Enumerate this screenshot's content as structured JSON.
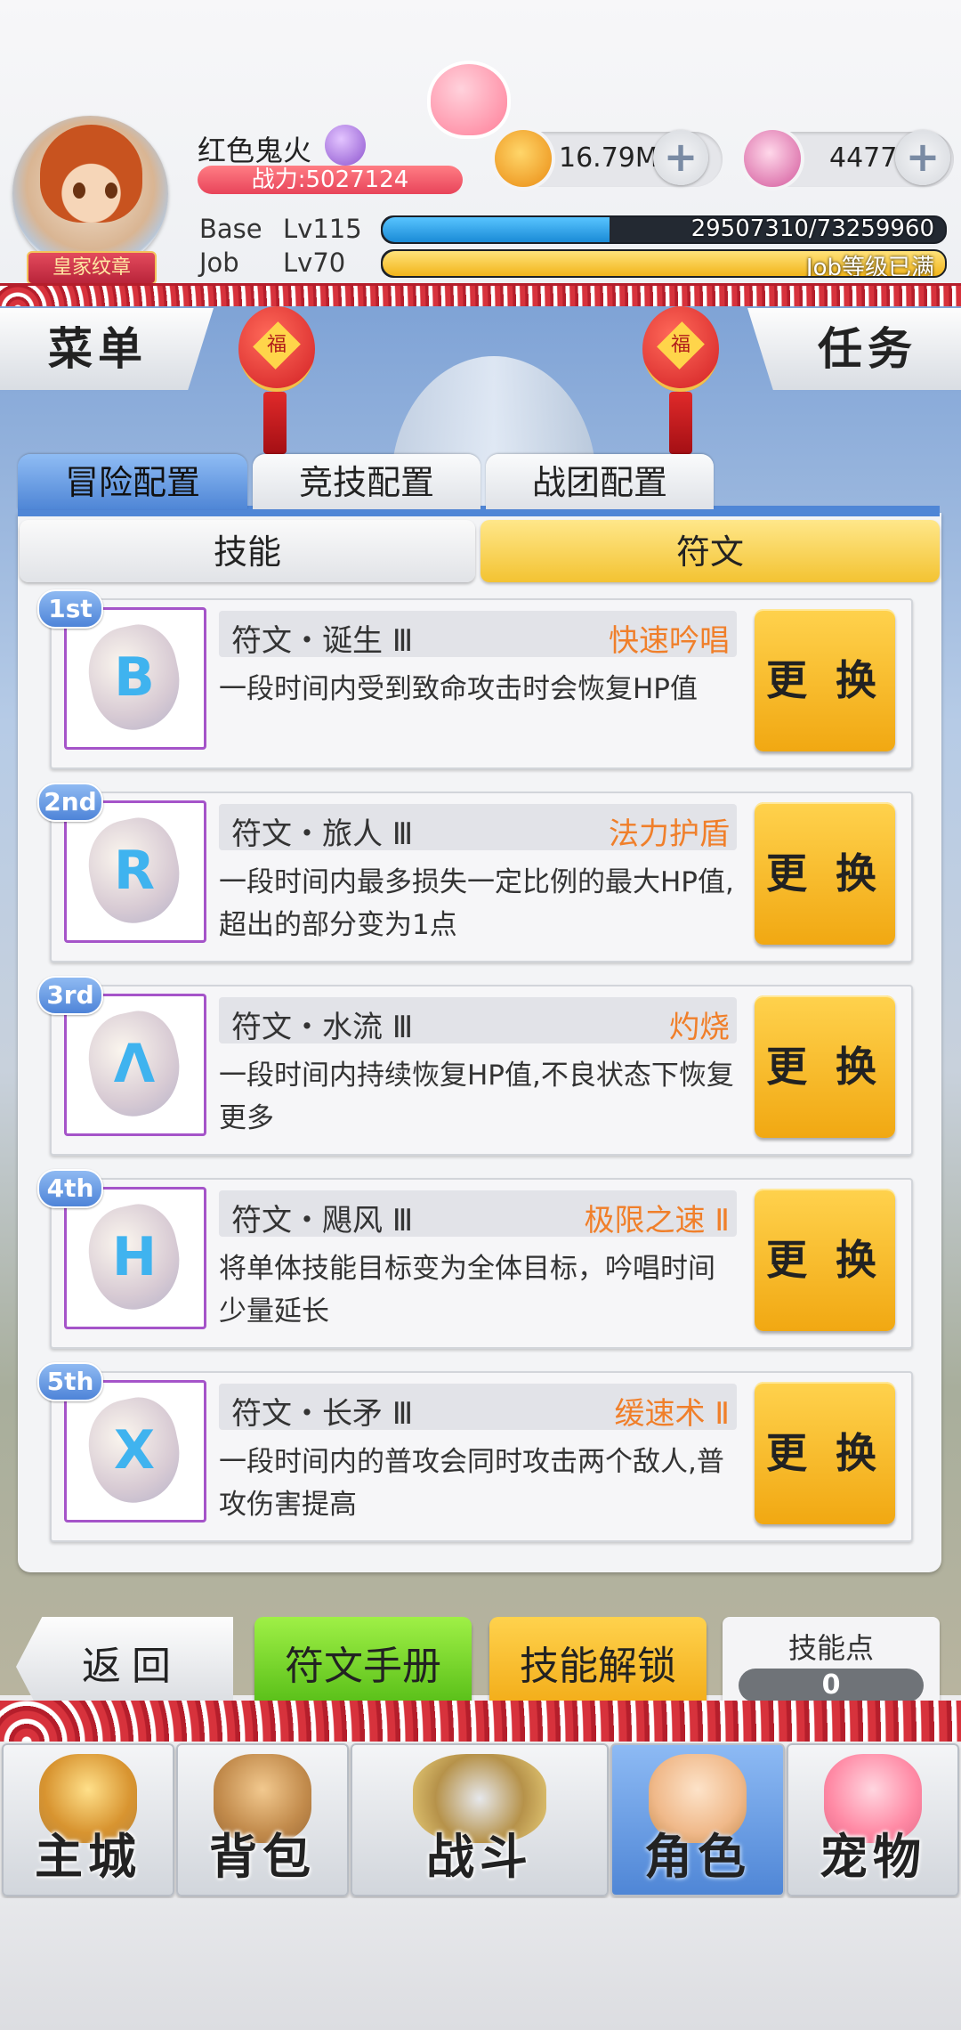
{
  "player": {
    "name": "红色鬼火",
    "badge": "皇家纹章",
    "power": "战力:5027124"
  },
  "currency": {
    "zeny": "16.79M",
    "gems": "4477",
    "plus_symbol": "+"
  },
  "levels": {
    "base_label": "Base",
    "base_level": "Lv115",
    "base_exp": "29507310/73259960",
    "base_progress": 0.403,
    "job_label": "Job",
    "job_level": "Lv70",
    "job_exp": "Job等级已满",
    "job_progress": 1.0
  },
  "side_buttons": {
    "menu": "菜单",
    "task": "任务"
  },
  "lanterns": {
    "char": "福"
  },
  "config_tabs": [
    "冒险配置",
    "竞技配置",
    "战团配置"
  ],
  "sub_tabs": [
    "技能",
    "符文"
  ],
  "runes": [
    {
      "rank": "1st",
      "glyph": "B",
      "name": "符文・诞生 Ⅲ",
      "skill": "快速吟唱",
      "desc": "一段时间内受到致命攻击时会恢复HP值",
      "button": "更 换"
    },
    {
      "rank": "2nd",
      "glyph": "R",
      "name": "符文・旅人 Ⅲ",
      "skill": "法力护盾",
      "desc": "一段时间内最多损失一定比例的最大HP值,超出的部分变为1点",
      "button": "更 换"
    },
    {
      "rank": "3rd",
      "glyph": "Λ",
      "name": "符文・水流 Ⅲ",
      "skill": "灼烧",
      "desc": "一段时间内持续恢复HP值,不良状态下恢复更多",
      "button": "更 换"
    },
    {
      "rank": "4th",
      "glyph": "H",
      "name": "符文・飓风 Ⅲ",
      "skill": "极限之速 Ⅱ",
      "desc": "将单体技能目标变为全体目标，吟唱时间少量延长",
      "button": "更 换"
    },
    {
      "rank": "5th",
      "glyph": "X",
      "name": "符文・长矛 Ⅲ",
      "skill": "缓速术 Ⅱ",
      "desc": "一段时间内的普攻会同时攻击两个敌人,普攻伤害提高",
      "button": "更 换"
    }
  ],
  "actions": {
    "back": "返回",
    "rune_manual": "符文手册",
    "skill_unlock": "技能解锁",
    "skill_points_label": "技能点",
    "skill_points": "0"
  },
  "nav": [
    "主城",
    "背包",
    "战斗",
    "角色",
    "宠物"
  ],
  "colors": {
    "accent_blue": "#4f86d6",
    "button_gold": "#f1a812",
    "skill_orange": "#f07f2a",
    "manual_green": "#4fb812"
  }
}
